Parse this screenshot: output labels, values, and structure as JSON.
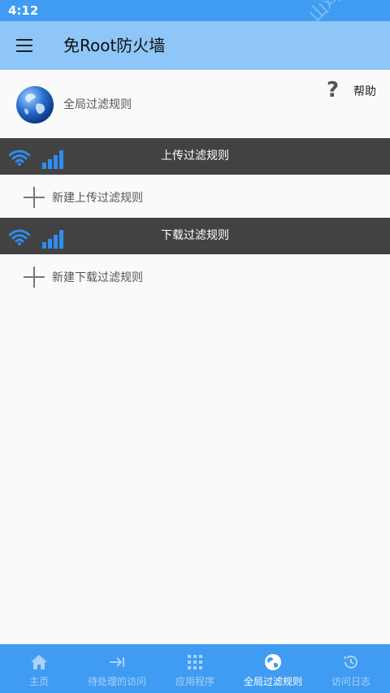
{
  "status_bar": {
    "time": "4:12"
  },
  "app_bar": {
    "title": "免Root防火墙",
    "menu_icon": "hamburger-menu-icon"
  },
  "header": {
    "global_label": "全局过滤规则",
    "help_label": "帮助",
    "help_glyph": "?",
    "globe_icon": "globe-icon"
  },
  "upload_section": {
    "title": "上传过滤规则",
    "add_label": "新建上传过滤规则"
  },
  "download_section": {
    "title": "下载过滤规则",
    "add_label": "新建下载过滤规则"
  },
  "bottom_nav": {
    "items": [
      {
        "label": "主页",
        "icon": "home-icon"
      },
      {
        "label": "待处理的访问",
        "icon": "arrow-to-bar-icon"
      },
      {
        "label": "应用程序",
        "icon": "grid-icon"
      },
      {
        "label": "全局过滤规则",
        "icon": "globe-icon",
        "active": true
      },
      {
        "label": "访问日志",
        "icon": "history-icon"
      }
    ]
  },
  "watermark": {
    "text": "山鸡手游网"
  },
  "colors": {
    "status_bar": "#3f9cf2",
    "app_bar": "#8ec7f7",
    "section_header": "#424242",
    "accent_blue": "#2f8cf0",
    "bottom_nav": "#3f9cf2"
  }
}
